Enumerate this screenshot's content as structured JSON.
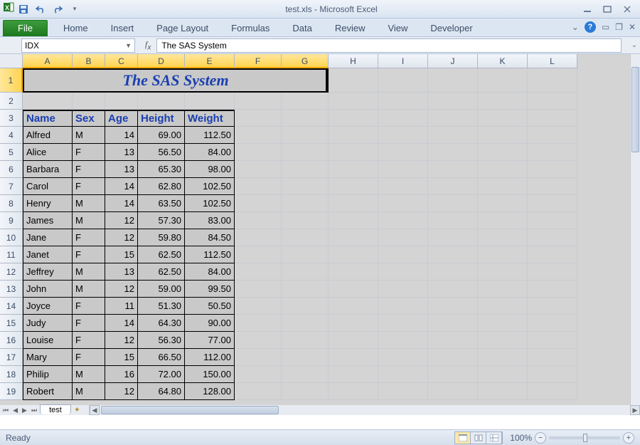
{
  "app": {
    "title": "test.xls  -  Microsoft Excel",
    "name_box": "IDX",
    "formula": "The SAS System",
    "status": "Ready",
    "zoom": "100%",
    "sheet_tab": "test"
  },
  "ribbon": {
    "file": "File",
    "tabs": [
      "Home",
      "Insert",
      "Page Layout",
      "Formulas",
      "Data",
      "Review",
      "View",
      "Developer"
    ]
  },
  "columns": [
    "A",
    "B",
    "C",
    "D",
    "E",
    "F",
    "G",
    "H",
    "I",
    "J",
    "K",
    "L"
  ],
  "selected_cols": [
    "A",
    "B",
    "C",
    "D",
    "E",
    "F",
    "G"
  ],
  "title_cell": "The SAS System",
  "headers": [
    "Name",
    "Sex",
    "Age",
    "Height",
    "Weight"
  ],
  "rows": [
    {
      "n": "Alfred",
      "s": "M",
      "a": "14",
      "h": "69.00",
      "w": "112.50"
    },
    {
      "n": "Alice",
      "s": "F",
      "a": "13",
      "h": "56.50",
      "w": "84.00"
    },
    {
      "n": "Barbara",
      "s": "F",
      "a": "13",
      "h": "65.30",
      "w": "98.00"
    },
    {
      "n": "Carol",
      "s": "F",
      "a": "14",
      "h": "62.80",
      "w": "102.50"
    },
    {
      "n": "Henry",
      "s": "M",
      "a": "14",
      "h": "63.50",
      "w": "102.50"
    },
    {
      "n": "James",
      "s": "M",
      "a": "12",
      "h": "57.30",
      "w": "83.00"
    },
    {
      "n": "Jane",
      "s": "F",
      "a": "12",
      "h": "59.80",
      "w": "84.50"
    },
    {
      "n": "Janet",
      "s": "F",
      "a": "15",
      "h": "62.50",
      "w": "112.50"
    },
    {
      "n": "Jeffrey",
      "s": "M",
      "a": "13",
      "h": "62.50",
      "w": "84.00"
    },
    {
      "n": "John",
      "s": "M",
      "a": "12",
      "h": "59.00",
      "w": "99.50"
    },
    {
      "n": "Joyce",
      "s": "F",
      "a": "11",
      "h": "51.30",
      "w": "50.50"
    },
    {
      "n": "Judy",
      "s": "F",
      "a": "14",
      "h": "64.30",
      "w": "90.00"
    },
    {
      "n": "Louise",
      "s": "F",
      "a": "12",
      "h": "56.30",
      "w": "77.00"
    },
    {
      "n": "Mary",
      "s": "F",
      "a": "15",
      "h": "66.50",
      "w": "112.00"
    },
    {
      "n": "Philip",
      "s": "M",
      "a": "16",
      "h": "72.00",
      "w": "150.00"
    },
    {
      "n": "Robert",
      "s": "M",
      "a": "12",
      "h": "64.80",
      "w": "128.00"
    }
  ],
  "chart_data": {
    "type": "table",
    "title": "The SAS System",
    "columns": [
      "Name",
      "Sex",
      "Age",
      "Height",
      "Weight"
    ],
    "data": [
      [
        "Alfred",
        "M",
        14,
        69.0,
        112.5
      ],
      [
        "Alice",
        "F",
        13,
        56.5,
        84.0
      ],
      [
        "Barbara",
        "F",
        13,
        65.3,
        98.0
      ],
      [
        "Carol",
        "F",
        14,
        62.8,
        102.5
      ],
      [
        "Henry",
        "M",
        14,
        63.5,
        102.5
      ],
      [
        "James",
        "M",
        12,
        57.3,
        83.0
      ],
      [
        "Jane",
        "F",
        12,
        59.8,
        84.5
      ],
      [
        "Janet",
        "F",
        15,
        62.5,
        112.5
      ],
      [
        "Jeffrey",
        "M",
        13,
        62.5,
        84.0
      ],
      [
        "John",
        "M",
        12,
        59.0,
        99.5
      ],
      [
        "Joyce",
        "F",
        11,
        51.3,
        50.5
      ],
      [
        "Judy",
        "F",
        14,
        64.3,
        90.0
      ],
      [
        "Louise",
        "F",
        12,
        56.3,
        77.0
      ],
      [
        "Mary",
        "F",
        15,
        66.5,
        112.0
      ],
      [
        "Philip",
        "M",
        16,
        72.0,
        150.0
      ],
      [
        "Robert",
        "M",
        12,
        64.8,
        128.0
      ]
    ]
  }
}
